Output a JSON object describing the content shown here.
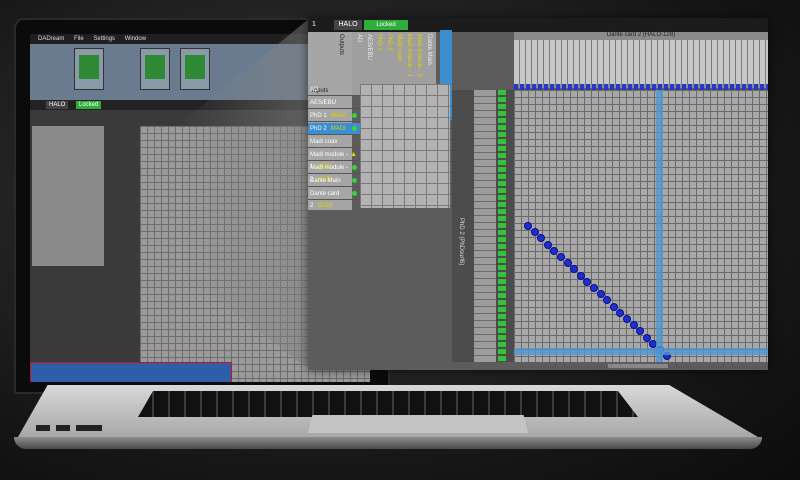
{
  "laptop_app": {
    "menu": [
      "DADream",
      "File",
      "Settings",
      "Window"
    ],
    "title_tag": "HALO",
    "locked_tag": "Locked"
  },
  "panel": {
    "row_number": "1",
    "device": "HALO",
    "lock_status": "Locked",
    "outputs_header": "Outputs",
    "inputs_header": "Inputs",
    "output_columns": [
      {
        "label": "AD",
        "color": "#eeeeee"
      },
      {
        "label": "AES/EBU",
        "color": "#eeeeee"
      },
      {
        "label": "PhD 1",
        "color": "#e3d000"
      },
      {
        "label": "PhD 2",
        "color": "#e3d000"
      },
      {
        "label": "Madi coax",
        "color": "#e3d000"
      },
      {
        "label": "Madi module - 1",
        "color": "#e3d000"
      },
      {
        "label": "Madi module - 2",
        "color": "#e3d000"
      },
      {
        "label": "Dante Main",
        "color": "#eeeeee"
      }
    ],
    "input_rows": [
      {
        "label": "AD",
        "sub": "",
        "indicator": "none",
        "selected": false
      },
      {
        "label": "AES/EBU",
        "sub": "",
        "indicator": "none",
        "selected": false
      },
      {
        "label": "PhD 1",
        "sub": "MADI",
        "indicator": "green",
        "selected": false
      },
      {
        "label": "PhD 2",
        "sub": "MADI",
        "indicator": "green",
        "selected": true
      },
      {
        "label": "Madi coax",
        "sub": "",
        "indicator": "none",
        "selected": false
      },
      {
        "label": "Madi module - 1",
        "sub": "MADI",
        "indicator": "warning",
        "selected": false
      },
      {
        "label": "Madi module - 2",
        "sub": "MADI",
        "indicator": "green",
        "selected": false
      },
      {
        "label": "Dante Main",
        "sub": "",
        "indicator": "green",
        "selected": false
      },
      {
        "label": "Dante card 2",
        "sub": "MADI",
        "indicator": "green",
        "selected": false
      }
    ],
    "dante_header": "Dante card 2 (HALO-128)",
    "side_group_label": "PhD 2 (PhDsurf6)",
    "diagonal_connections": 22,
    "colors": {
      "led": "#35c23a",
      "connection": "#1c2ed6",
      "highlight": "#3b8fd1",
      "locked": "#2fae3b"
    }
  }
}
